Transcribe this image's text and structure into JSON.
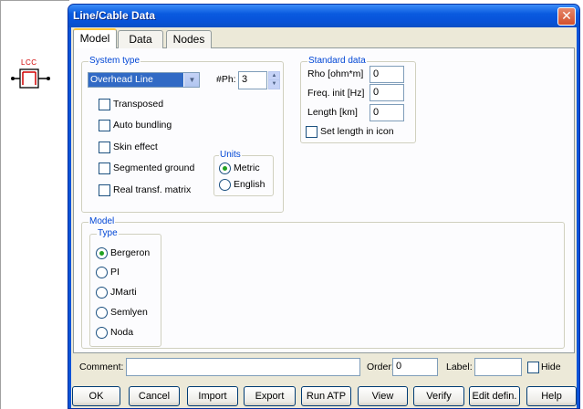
{
  "canvas": {
    "component_label": "LCC"
  },
  "window": {
    "title": "Line/Cable Data",
    "close_glyph": "✕"
  },
  "tabs": [
    {
      "label": "Model"
    },
    {
      "label": "Data"
    },
    {
      "label": "Nodes"
    }
  ],
  "system_type": {
    "legend": "System type",
    "selected": "Overhead Line",
    "phases_label": "#Ph:",
    "phases_value": "3",
    "options": [
      {
        "label": "Transposed",
        "checked": false
      },
      {
        "label": "Auto bundling",
        "checked": false
      },
      {
        "label": "Skin effect",
        "checked": false
      },
      {
        "label": "Segmented ground",
        "checked": false
      },
      {
        "label": "Real transf. matrix",
        "checked": false
      }
    ],
    "units": {
      "legend": "Units",
      "options": [
        {
          "label": "Metric",
          "selected": true
        },
        {
          "label": "English",
          "selected": false
        }
      ]
    }
  },
  "standard_data": {
    "legend": "Standard data",
    "rho_label": "Rho [ohm*m]",
    "rho_value": "0",
    "freq_label": "Freq. init [Hz]",
    "freq_value": "0",
    "length_label": "Length [km]",
    "length_value": "0",
    "set_length_label": "Set length in icon"
  },
  "model": {
    "legend": "Model",
    "type_legend": "Type",
    "types": [
      {
        "label": "Bergeron",
        "selected": true
      },
      {
        "label": "PI",
        "selected": false
      },
      {
        "label": "JMarti",
        "selected": false
      },
      {
        "label": "Semlyen",
        "selected": false
      },
      {
        "label": "Noda",
        "selected": false
      }
    ]
  },
  "footer": {
    "comment_label": "Comment:",
    "comment_value": "",
    "order_label": "Order:",
    "order_value": "0",
    "label_label": "Label:",
    "label_value": "",
    "hide_label": "Hide"
  },
  "buttons": {
    "ok": "OK",
    "cancel": "Cancel",
    "import": "Import",
    "export": "Export",
    "run_atp": "Run ATP",
    "view": "View",
    "verify": "Verify",
    "edit_defin": "Edit defin.",
    "help": "Help"
  },
  "colors": {
    "title_bar": "#0a5be0",
    "dialog_face": "#ece9d8",
    "legend_text": "#0046d5",
    "radio_dot": "#21a121",
    "selection": "#316ac5",
    "canvas_label": "#d00000"
  }
}
